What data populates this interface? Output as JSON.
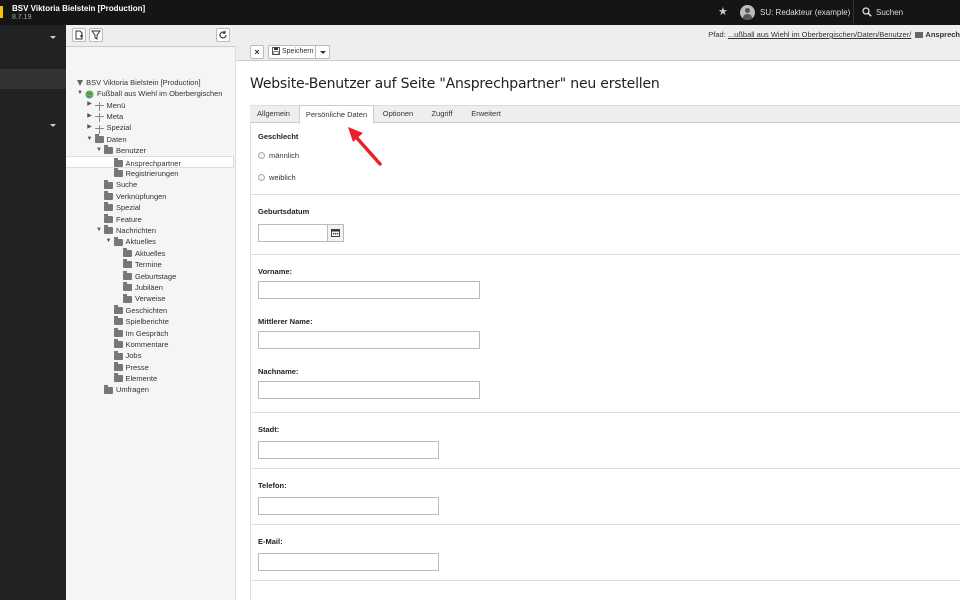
{
  "topbar": {
    "site_name": "BSV Viktoria Bielstein [Production]",
    "site_version": "8.7.19",
    "user": "SU: Redakteur (example)",
    "search_label": "Suchen",
    "icons": [
      "bookmark-star-icon",
      "avatar-icon",
      "search-icon"
    ]
  },
  "doc_header": {
    "path_label": "Pfad:",
    "path_link": "...ußball aus Wiehl im Oberbergischen/Daten/Benutzer/",
    "path_current": "Ansprech",
    "save_label": "Speichern"
  },
  "tree": {
    "root": "BSV Viktoria Bielstein [Production]",
    "items": [
      {
        "label": "Fußball aus Wiehl im Oberbergischen",
        "level": 0,
        "toggle": "open",
        "icon": "globe"
      },
      {
        "label": "Menü",
        "level": 1,
        "toggle": "closed",
        "icon": "plain"
      },
      {
        "label": "Meta",
        "level": 1,
        "toggle": "closed",
        "icon": "plain"
      },
      {
        "label": "Spezial",
        "level": 1,
        "toggle": "closed",
        "icon": "plain"
      },
      {
        "label": "Daten",
        "level": 1,
        "toggle": "open",
        "icon": "folder"
      },
      {
        "label": "Benutzer",
        "level": 2,
        "toggle": "open",
        "icon": "folder"
      },
      {
        "label": "Ansprechpartner",
        "level": 3,
        "toggle": "",
        "icon": "folder",
        "selected": true
      },
      {
        "label": "Registrierungen",
        "level": 3,
        "toggle": "",
        "icon": "folder"
      },
      {
        "label": "Suche",
        "level": 2,
        "toggle": "",
        "icon": "folder"
      },
      {
        "label": "Verknüpfungen",
        "level": 2,
        "toggle": "",
        "icon": "folder"
      },
      {
        "label": "Spezial",
        "level": 2,
        "toggle": "",
        "icon": "folder"
      },
      {
        "label": "Feature",
        "level": 2,
        "toggle": "",
        "icon": "folder"
      },
      {
        "label": "Nachrichten",
        "level": 2,
        "toggle": "open",
        "icon": "folder"
      },
      {
        "label": "Aktuelles",
        "level": 3,
        "toggle": "open",
        "icon": "folder"
      },
      {
        "label": "Aktuelles",
        "level": 4,
        "toggle": "",
        "icon": "folder"
      },
      {
        "label": "Termine",
        "level": 4,
        "toggle": "",
        "icon": "folder"
      },
      {
        "label": "Geburtstage",
        "level": 4,
        "toggle": "",
        "icon": "folder"
      },
      {
        "label": "Jubiläen",
        "level": 4,
        "toggle": "",
        "icon": "folder"
      },
      {
        "label": "Verweise",
        "level": 4,
        "toggle": "",
        "icon": "folder"
      },
      {
        "label": "Geschichten",
        "level": 3,
        "toggle": "",
        "icon": "folder"
      },
      {
        "label": "Spielberichte",
        "level": 3,
        "toggle": "",
        "icon": "folder"
      },
      {
        "label": "Im Gespräch",
        "level": 3,
        "toggle": "",
        "icon": "folder"
      },
      {
        "label": "Kommentare",
        "level": 3,
        "toggle": "",
        "icon": "folder"
      },
      {
        "label": "Jobs",
        "level": 3,
        "toggle": "",
        "icon": "folder"
      },
      {
        "label": "Presse",
        "level": 3,
        "toggle": "",
        "icon": "folder"
      },
      {
        "label": "Elemente",
        "level": 3,
        "toggle": "",
        "icon": "folder"
      },
      {
        "label": "Umfragen",
        "level": 2,
        "toggle": "",
        "icon": "folder"
      }
    ]
  },
  "form": {
    "title": "Website-Benutzer auf Seite \"Ansprechpartner\" neu erstellen",
    "tabs": [
      "Allgemein",
      "Persönliche Daten",
      "Optionen",
      "Zugriff",
      "Erweitert"
    ],
    "active_tab": 1,
    "gender_label": "Geschlecht",
    "gender_options": [
      "männlich",
      "weiblich"
    ],
    "birthdate_label": "Geburtsdatum",
    "firstname_label": "Vorname:",
    "middlename_label": "Mittlerer Name:",
    "lastname_label": "Nachname:",
    "city_label": "Stadt:",
    "phone_label": "Telefon:",
    "email_label": "E-Mail:"
  },
  "colors": {
    "topbar": "#151515",
    "module_menu": "#222222",
    "accent_logo": "#f5c400",
    "annotation_arrow": "#e8202a"
  }
}
